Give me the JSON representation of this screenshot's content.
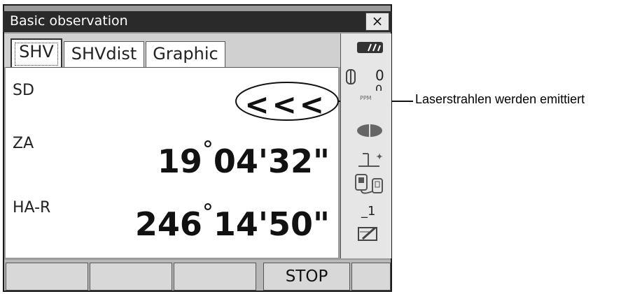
{
  "window": {
    "title": "Basic observation",
    "close_label": "×"
  },
  "tabs": [
    {
      "label": "SHV",
      "active": true
    },
    {
      "label": "SHVdist",
      "active": false
    },
    {
      "label": "Graphic",
      "active": false
    }
  ],
  "measurements": {
    "sd_label": "SD",
    "sd_value": "<<<",
    "za_label": "ZA",
    "za_deg": "19",
    "za_rest": "04'32\"",
    "har_label": "HA-R",
    "har_deg": "246",
    "har_rest": "14'50\""
  },
  "status": {
    "battery_icon": "battery-icon",
    "prism_constant": "0",
    "ppm_value": "0",
    "ppm_label": "PPM",
    "target_icon": "target-icon",
    "tilt_icon": "tilt-icon",
    "comm_icon": "communication-icon",
    "input_mode": "_1",
    "edit_icon": "edit-icon"
  },
  "softkeys": [
    "",
    "",
    "",
    "STOP",
    ""
  ],
  "callout": {
    "text": "Laserstrahlen werden emittiert"
  },
  "colors": {
    "titlebar": "#2a2a2a",
    "frame": "#9a9a9a",
    "screen": "#ffffff"
  }
}
